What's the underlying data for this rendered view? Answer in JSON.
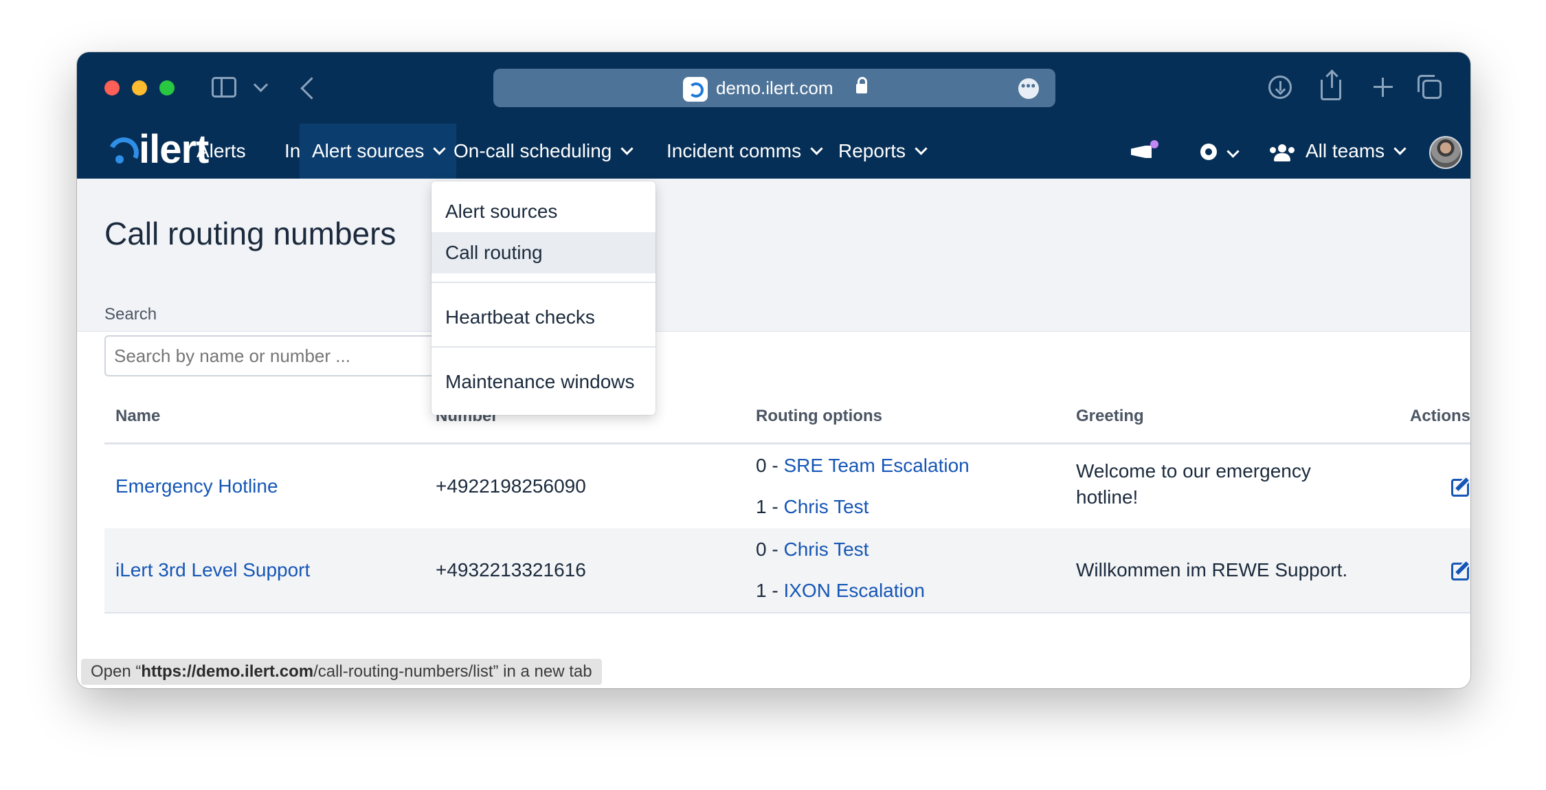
{
  "browser": {
    "url": "demo.ilert.com",
    "more_label": "•••"
  },
  "nav": {
    "logo": "ilert",
    "items": [
      {
        "label": "Alerts"
      },
      {
        "label": "Incidents"
      },
      {
        "label": "Alert sources"
      },
      {
        "label": "On-call scheduling"
      },
      {
        "label": "Incident comms"
      },
      {
        "label": "Reports"
      }
    ],
    "teams_label": "All teams"
  },
  "dropdown": {
    "items": [
      {
        "label": "Alert sources"
      },
      {
        "label": "Call routing",
        "highlighted": true
      },
      {
        "label": "Heartbeat checks"
      },
      {
        "label": "Maintenance windows"
      }
    ]
  },
  "page": {
    "title": "Call routing numbers",
    "search_label": "Search",
    "search_placeholder": "Search by name or number ..."
  },
  "table": {
    "columns": [
      "Name",
      "Number",
      "Routing options",
      "Greeting",
      "Actions"
    ],
    "rows": [
      {
        "name": "Emergency Hotline",
        "number": "+4922198256090",
        "routes": [
          {
            "key": "0 -",
            "target": "SRE Team Escalation"
          },
          {
            "key": "1 -",
            "target": "Chris Test"
          }
        ],
        "greeting": "Welcome to our emergency hotline!"
      },
      {
        "name": "iLert 3rd Level Support",
        "number": "+4932213321616",
        "routes": [
          {
            "key": "0 -",
            "target": "Chris Test"
          },
          {
            "key": "1 -",
            "target": "IXON Escalation"
          }
        ],
        "greeting": "Willkommen im REWE Support."
      }
    ]
  },
  "status_bar": {
    "prefix": "Open “",
    "host": "https://demo.ilert.com",
    "path": "/call-routing-numbers/list",
    "suffix": "” in a new tab"
  }
}
